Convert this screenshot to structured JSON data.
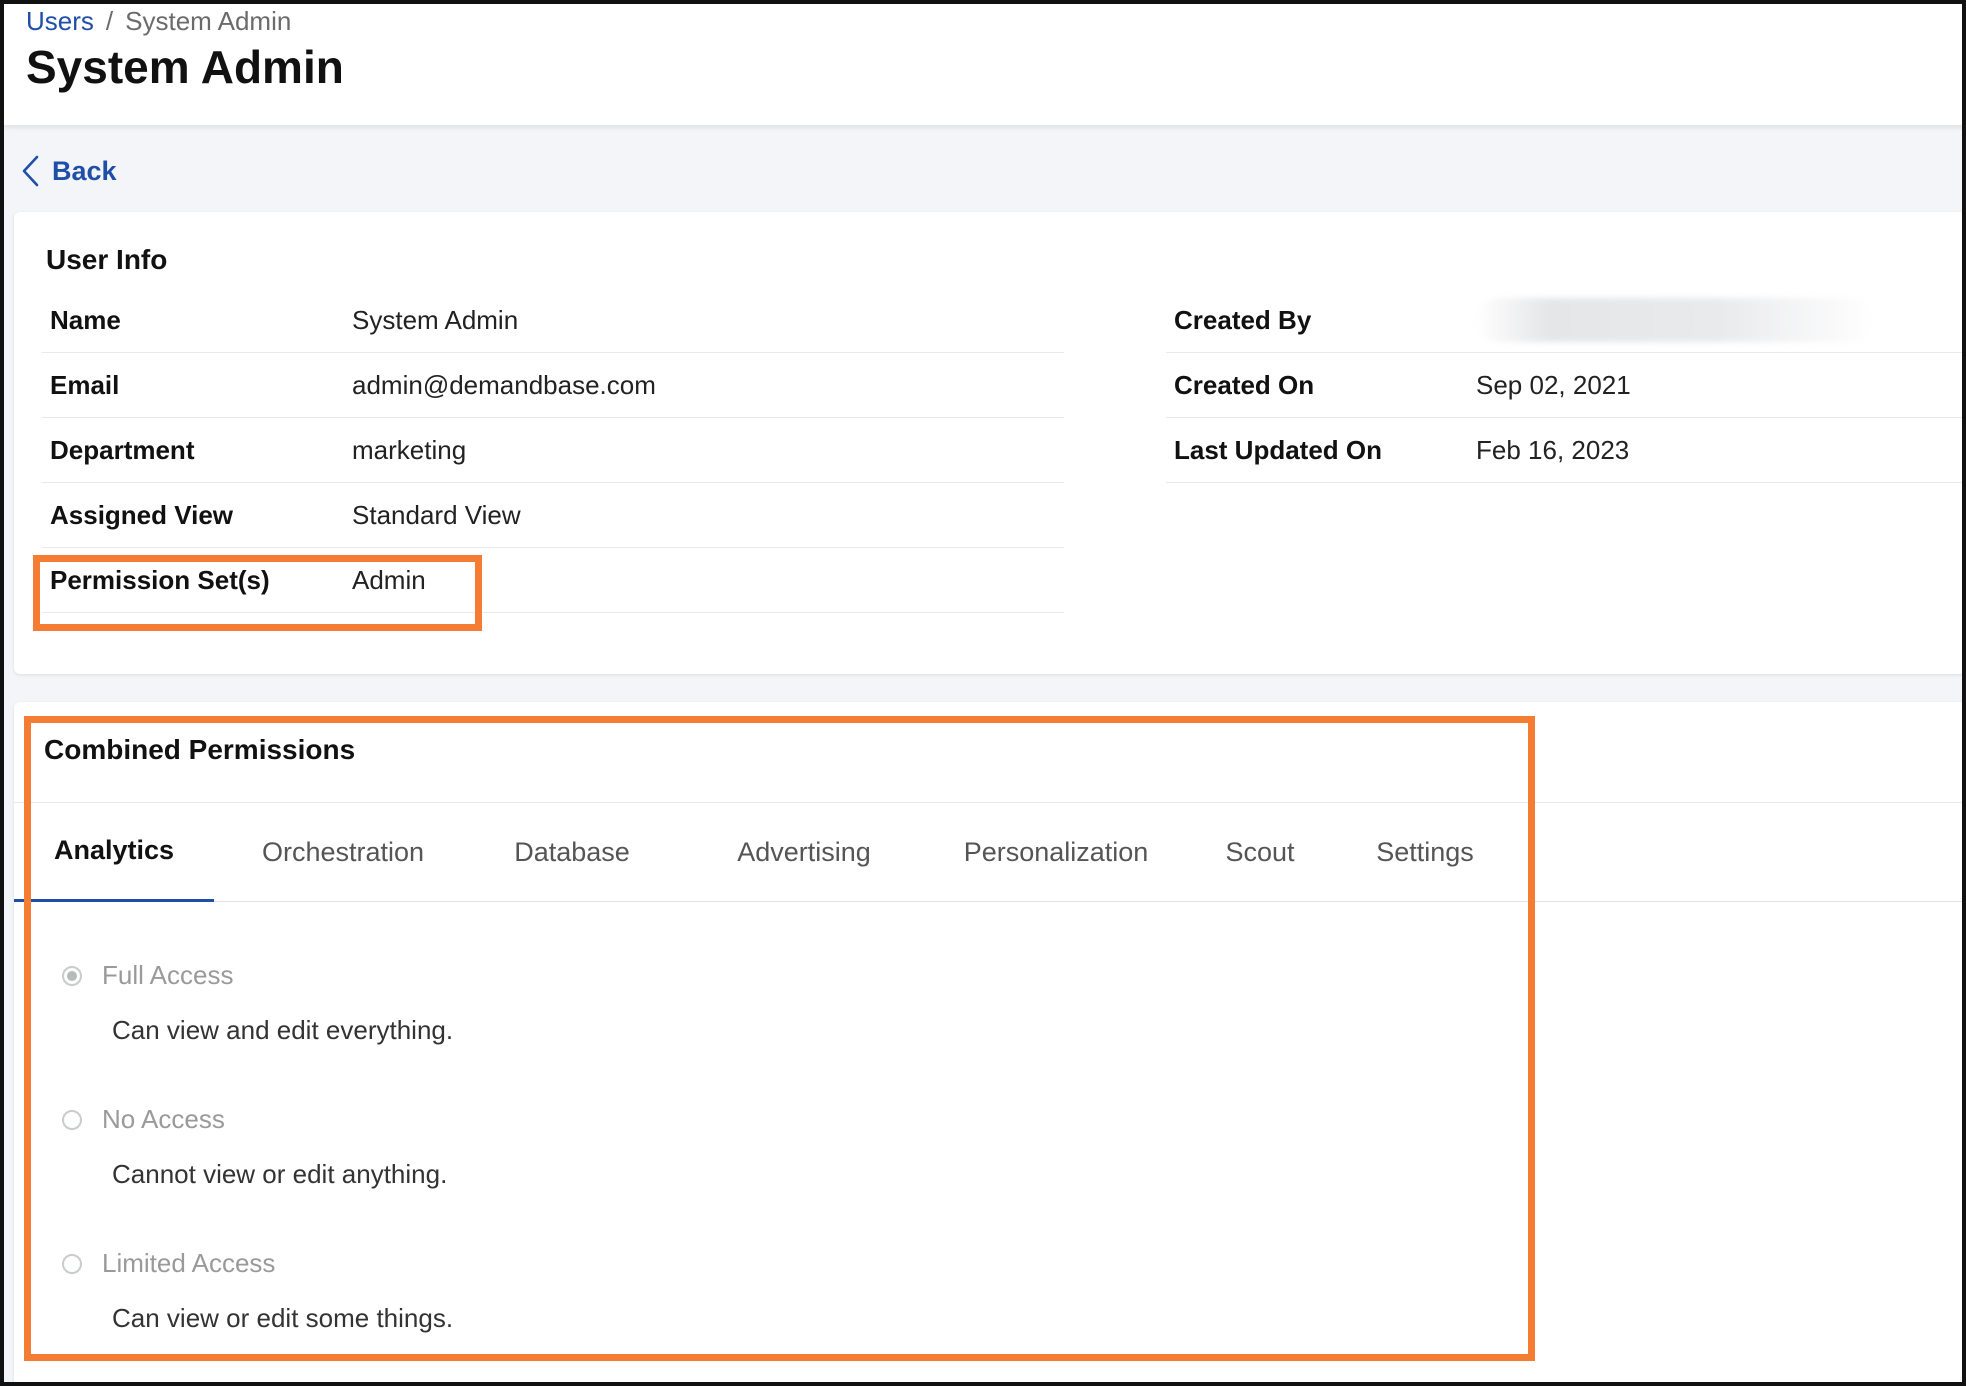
{
  "breadcrumb": {
    "parent": "Users",
    "separator": "/",
    "current": "System Admin"
  },
  "page": {
    "title": "System Admin",
    "back_label": "Back"
  },
  "user_info": {
    "title": "User Info",
    "left": [
      {
        "label": "Name",
        "value": "System Admin"
      },
      {
        "label": "Email",
        "value": "admin@demandbase.com"
      },
      {
        "label": "Department",
        "value": "marketing"
      },
      {
        "label": "Assigned View",
        "value": "Standard View"
      },
      {
        "label": "Permission Set(s)",
        "value": "Admin"
      }
    ],
    "right": [
      {
        "label": "Created By",
        "value": ""
      },
      {
        "label": "Created On",
        "value": "Sep 02, 2021"
      },
      {
        "label": "Last Updated On",
        "value": "Feb 16, 2023"
      }
    ]
  },
  "permissions": {
    "title": "Combined Permissions",
    "tabs": [
      "Analytics",
      "Orchestration",
      "Database",
      "Advertising",
      "Personalization",
      "Scout",
      "Settings"
    ],
    "active_tab": "Analytics",
    "options": [
      {
        "label": "Full Access",
        "description": "Can view and edit everything.",
        "selected": true
      },
      {
        "label": "No Access",
        "description": "Cannot view or edit anything.",
        "selected": false
      },
      {
        "label": "Limited Access",
        "description": "Can view or edit some things.",
        "selected": false
      }
    ]
  },
  "colors": {
    "link": "#1f4fa8",
    "highlight": "#f47d33",
    "active_tab_underline": "#1f4fa8"
  },
  "icons": {
    "back": "chevron-left-icon"
  }
}
